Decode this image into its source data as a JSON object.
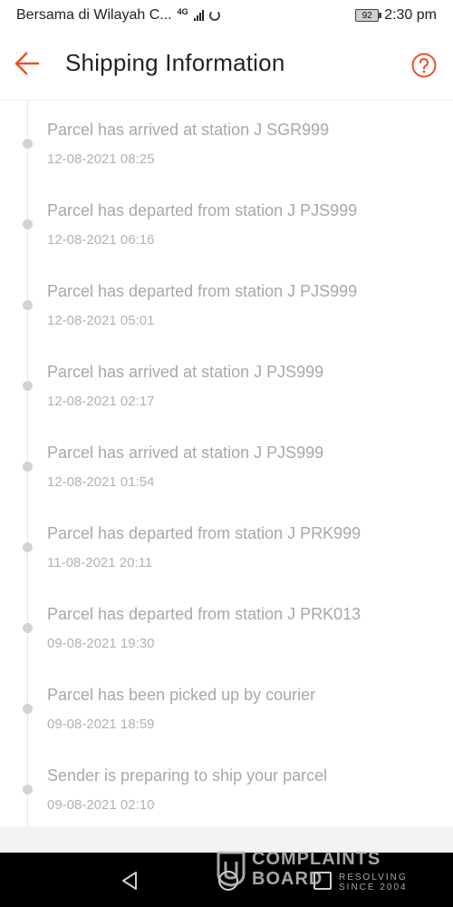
{
  "status_bar": {
    "carrier": "Bersama di Wilayah C...",
    "network": "4G",
    "battery_level": "92",
    "time": "2:30 pm"
  },
  "header": {
    "title": "Shipping Information",
    "back_icon": "arrow-left-icon",
    "help_icon": "question-circle-icon",
    "accent_color": "#ee4d2d"
  },
  "timeline": [
    {
      "text": "Parcel has arrived at station J SGR999",
      "time": "12-08-2021 08:25"
    },
    {
      "text": "Parcel has departed from station J PJS999",
      "time": "12-08-2021 06:16"
    },
    {
      "text": "Parcel has departed from station J PJS999",
      "time": "12-08-2021 05:01"
    },
    {
      "text": "Parcel has arrived at station J PJS999",
      "time": "12-08-2021 02:17"
    },
    {
      "text": "Parcel has arrived at station J PJS999",
      "time": "12-08-2021 01:54"
    },
    {
      "text": "Parcel has departed from station J PRK999",
      "time": "11-08-2021 20:11"
    },
    {
      "text": "Parcel has departed from station J PRK013",
      "time": "09-08-2021 19:30"
    },
    {
      "text": "Parcel has been picked up by courier",
      "time": "09-08-2021 18:59"
    },
    {
      "text": "Sender is preparing to ship your parcel",
      "time": "09-08-2021 02:10"
    }
  ],
  "watermark": {
    "line1": "COMPLAINTS",
    "line2": "BOARD",
    "tagline1": "RESOLVING",
    "tagline2": "SINCE 2004"
  }
}
